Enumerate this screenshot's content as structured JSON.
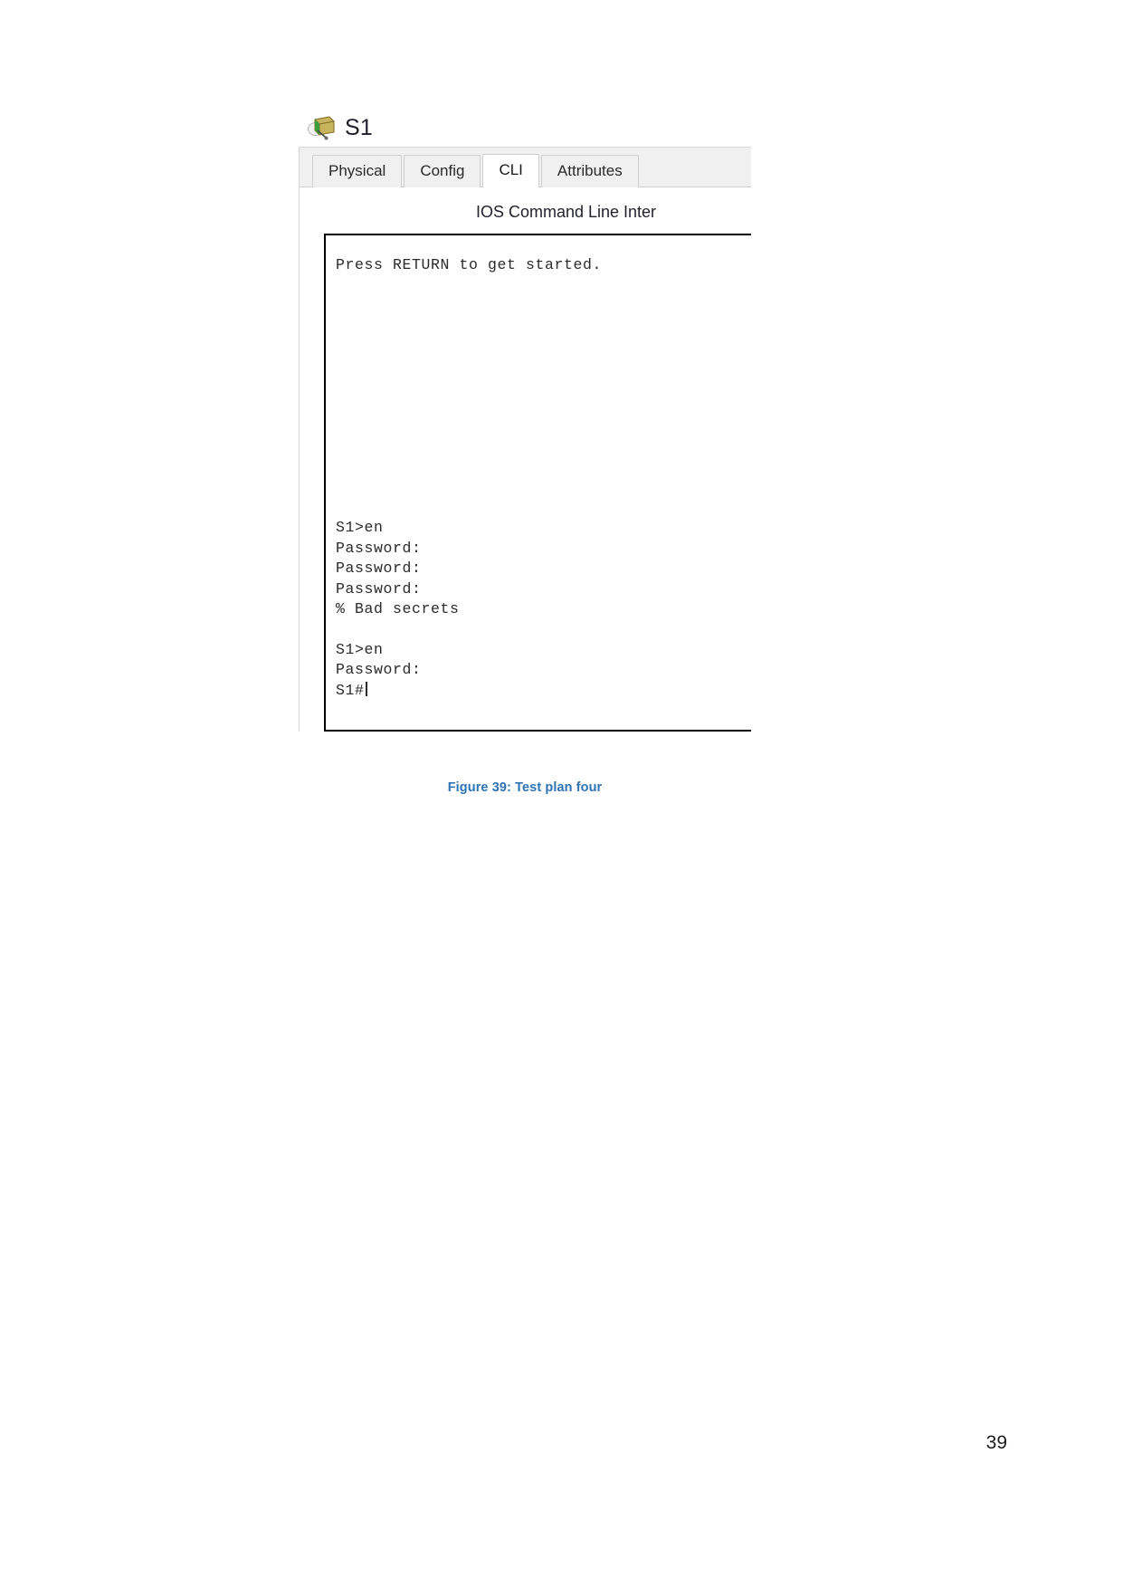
{
  "document": {
    "page_number": "39",
    "caption": "Figure 39: Test plan four"
  },
  "device_window": {
    "icon": "switch-icon",
    "title": "S1",
    "tabs": [
      {
        "label": "Physical",
        "active": false
      },
      {
        "label": "Config",
        "active": false
      },
      {
        "label": "CLI",
        "active": true
      },
      {
        "label": "Attributes",
        "active": false
      }
    ],
    "panel_heading": "IOS Command Line Inter",
    "terminal": {
      "intro_line": "Press RETURN to get started.",
      "session_lines": [
        "S1>en",
        "Password:",
        "Password:",
        "Password:",
        "% Bad secrets",
        "",
        "S1>en",
        "Password:",
        "S1#"
      ]
    }
  },
  "colors": {
    "caption_blue": "#2e74b5",
    "terminal_text": "#2b2b2b",
    "window_chrome": "#f0f0f0",
    "tab_border": "#cfcfcf"
  }
}
